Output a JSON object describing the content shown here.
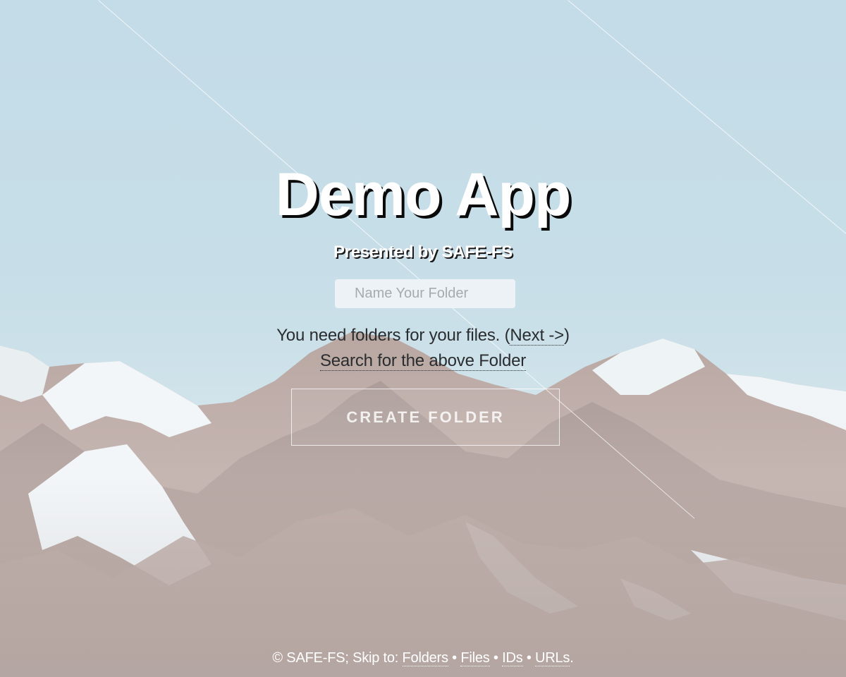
{
  "hero": {
    "title": "Demo App",
    "subtitle": "Presented by SAFE-FS"
  },
  "form": {
    "folder_placeholder": "Name Your Folder",
    "folder_value": "",
    "hint_text": "You need folders for your files. (",
    "next_link": "Next ->",
    "hint_close": ")",
    "search_link": "Search for the above Folder",
    "create_button": "CREATE FOLDER"
  },
  "footer": {
    "copyright": "© SAFE-FS; Skip to: ",
    "links": [
      "Folders",
      "Files",
      "IDs",
      "URLs"
    ],
    "separator": " • ",
    "end": "."
  },
  "colors": {
    "sky": "#c5dde8",
    "title_text": "#ffffff",
    "title_shadow": "#0a0a0a",
    "body_text": "#2a2d30"
  },
  "background": {
    "icon": "mountain-landscape"
  }
}
